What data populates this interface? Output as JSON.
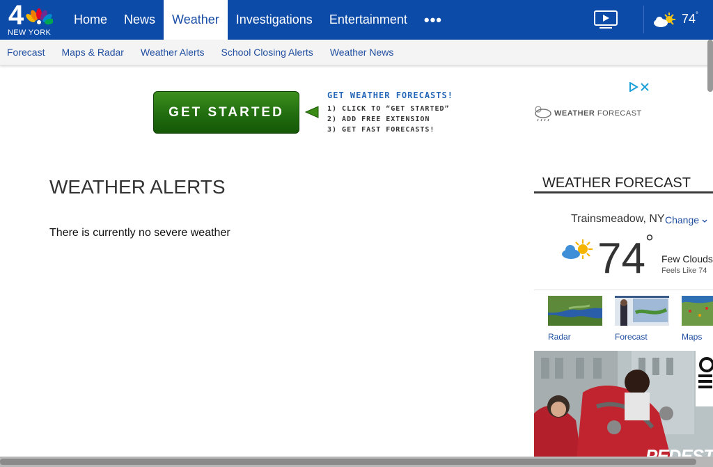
{
  "header": {
    "logo_city": "NEW YORK",
    "logo_number": "4",
    "nav_items": [
      "Home",
      "News",
      "Weather",
      "Investigations",
      "Entertainment"
    ],
    "active_nav": "Weather",
    "more_label": "•••",
    "temperature": "74",
    "degree_symbol": "°",
    "colors": {
      "nav_bg": "#0d4ba8",
      "active_text": "#1b4ea5"
    }
  },
  "subnav": {
    "items": [
      "Forecast",
      "Maps & Radar",
      "Weather Alerts",
      "School Closing Alerts",
      "Weather News"
    ]
  },
  "ad": {
    "button_label": "GET STARTED",
    "headline": "GET WEATHER FORECASTS!",
    "lines": [
      "1) CLICK TO “GET STARTED”",
      "2) ADD FREE EXTENSION",
      "3) GET FAST FORECASTS!"
    ],
    "brand_bold": "WEATHER",
    "brand_rest": " FORECAST"
  },
  "main": {
    "title": "WEATHER ALERTS",
    "message": "There is currently no severe weather"
  },
  "sidebar": {
    "heading": "WEATHER FORECAST",
    "location": "Trainsmeadow, NY",
    "change_label": "Change",
    "temperature": "74",
    "degree": "°",
    "condition": "Few Clouds",
    "feels_like": "Feels Like 74",
    "thumbs": [
      {
        "label": "Radar",
        "icon": "radar-map-thumbnail"
      },
      {
        "label": "Forecast",
        "icon": "forecast-video-thumbnail"
      },
      {
        "label": "Maps",
        "icon": "maps-thumbnail"
      }
    ],
    "ad_text": "PEDESTRI"
  }
}
